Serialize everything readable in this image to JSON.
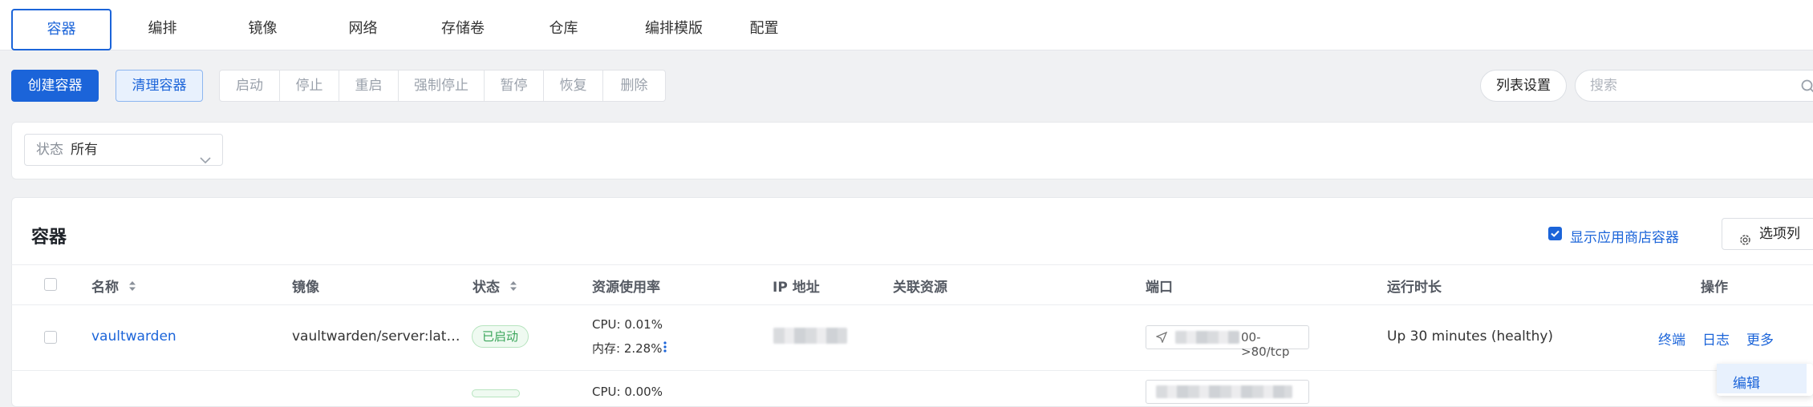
{
  "tabs": [
    "容器",
    "编排",
    "镜像",
    "网络",
    "存储卷",
    "仓库",
    "编排模版",
    "配置"
  ],
  "toolbar": {
    "create": "创建容器",
    "clean": "清理容器",
    "group": [
      "启动",
      "停止",
      "重启",
      "强制停止",
      "暂停",
      "恢复",
      "删除"
    ],
    "list_settings": "列表设置",
    "search_placeholder": "搜索"
  },
  "filter": {
    "label": "状态",
    "value": "所有"
  },
  "table": {
    "title": "容器",
    "show_appstore": "显示应用商店容器",
    "columns_button": "选项列",
    "headers": [
      "名称",
      "镜像",
      "状态",
      "资源使用率",
      "IP 地址",
      "关联资源",
      "端口",
      "运行时长",
      "操作"
    ],
    "rows": [
      {
        "name": "vaultwarden",
        "image": "vaultwarden/server:lat…",
        "status": "已启动",
        "cpu": "CPU: 0.01%",
        "mem": "内存: 2.28%",
        "port_suffix": "00->80/tcp",
        "uptime": "Up 30 minutes (healthy)",
        "actions": [
          "终端",
          "日志",
          "更多"
        ]
      },
      {
        "cpu": "CPU: 0.00%"
      }
    ],
    "dropdown_item": "编辑"
  },
  "colors": {
    "accent": "#1b64d9",
    "success": "#3aa55a"
  }
}
